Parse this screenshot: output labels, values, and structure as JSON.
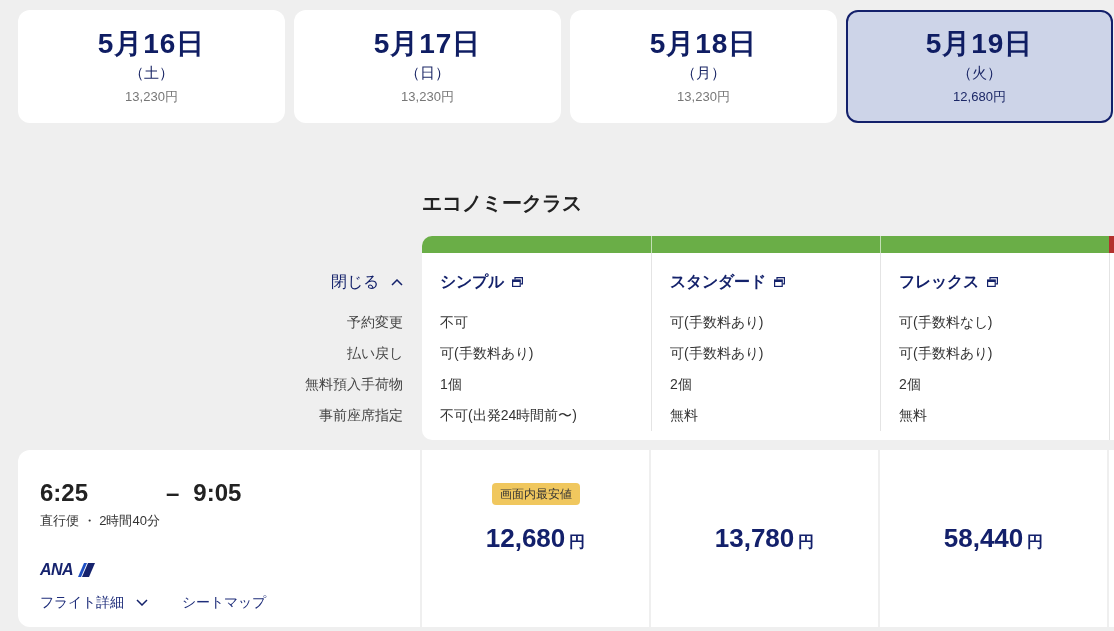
{
  "dates": [
    {
      "date": "5月16日",
      "weekday": "（土）",
      "price": "13,230円",
      "selected": false
    },
    {
      "date": "5月17日",
      "weekday": "（日）",
      "price": "13,230円",
      "selected": false
    },
    {
      "date": "5月18日",
      "weekday": "（月）",
      "price": "13,230円",
      "selected": false
    },
    {
      "date": "5月19日",
      "weekday": "（火）",
      "price": "12,680円",
      "selected": true
    }
  ],
  "fare_details": {
    "toggle": {
      "label": "閉じる",
      "expanded": true
    },
    "rows": [
      "予約変更",
      "払い戻し",
      "無料預入手荷物",
      "事前座席指定"
    ]
  },
  "classes": [
    {
      "name": "エコノミークラス",
      "color": "#6aae47",
      "fares": [
        {
          "name": "シンプル",
          "values": [
            "不可",
            "可(手数料あり)",
            "1個",
            "不可(出発24時間前〜)"
          ]
        },
        {
          "name": "スタンダード",
          "values": [
            "可(手数料あり)",
            "可(手数料あり)",
            "2個",
            "無料"
          ]
        },
        {
          "name": "フレックス",
          "values": [
            "可(手数料なし)",
            "可(手数料あり)",
            "2個",
            "無料"
          ]
        }
      ]
    },
    {
      "color": "#b3312d"
    }
  ],
  "flights": [
    {
      "departure": "6:25",
      "separator": "–",
      "arrival": "9:05",
      "info": "直行便 ・ 2時間40分",
      "airline": "ANA",
      "links": [
        {
          "label": "フライト詳細",
          "kind": "dropdown"
        },
        {
          "label": "シートマップ",
          "kind": "plain"
        }
      ],
      "prices": [
        {
          "badge": "画面内最安値",
          "amount": "12,680",
          "currency": "円"
        },
        {
          "amount": "13,780",
          "currency": "円"
        },
        {
          "amount": "58,440",
          "currency": "円"
        }
      ]
    }
  ]
}
